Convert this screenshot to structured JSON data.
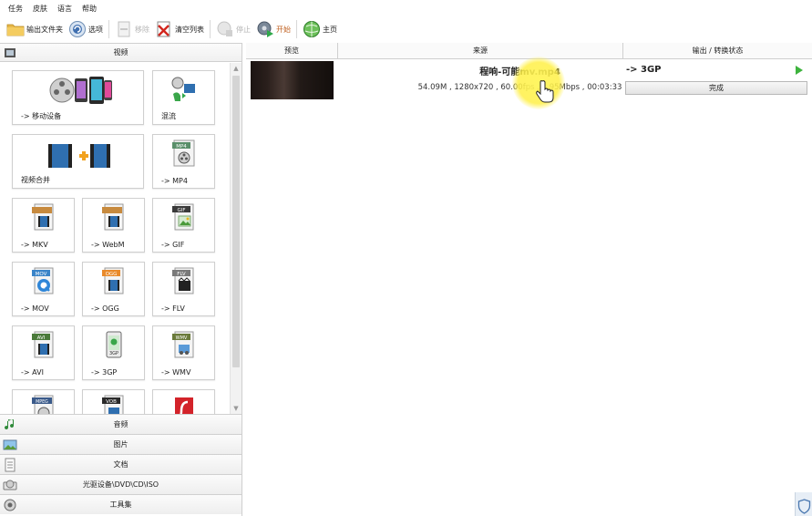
{
  "menu": {
    "items": [
      "任务",
      "皮肤",
      "语言",
      "帮助"
    ]
  },
  "toolbar": {
    "output_folder": "输出文件夹",
    "options": "选项",
    "remove": "移除",
    "clear_list": "清空列表",
    "stop": "停止",
    "start": "开始",
    "home": "主页"
  },
  "left_panel": {
    "header": "视频",
    "tiles": {
      "mobile": "-> 移动设备",
      "mix": "混流",
      "merge": "视频合并",
      "mp4": "-> MP4",
      "mkv": "-> MKV",
      "webm": "-> WebM",
      "gif": "-> GIF",
      "mov": "-> MOV",
      "ogg": "-> OGG",
      "flv": "-> FLV",
      "avi": "-> AVI",
      "3gp": "-> 3GP",
      "wmv": "-> WMV"
    },
    "badges": {
      "mp4": "MP4",
      "gif": "GIF",
      "mov": "MOV",
      "ogg": "OGG",
      "flv": "FLV",
      "avi": "AVI",
      "3gp": "3GP",
      "wmv": "WMV",
      "mpeg": "MPEG",
      "vob": "VOB"
    },
    "sections": [
      "音频",
      "图片",
      "文档",
      "光驱设备\\DVD\\CD\\ISO",
      "工具集"
    ]
  },
  "file_list": {
    "columns": {
      "preview": "预览",
      "source": "来源",
      "status": "输出 / 转换状态"
    },
    "rows": [
      {
        "name": "程响-可能mv.mp4",
        "info": "54.09M , 1280x720 , 60.00fps , 1.95Mbps , 00:03:33",
        "target": "-> 3GP",
        "status": "完成"
      }
    ]
  },
  "colors": {
    "accent_green": "#3db33d",
    "start_label": "#c06020",
    "highlight": "#fff05a"
  }
}
